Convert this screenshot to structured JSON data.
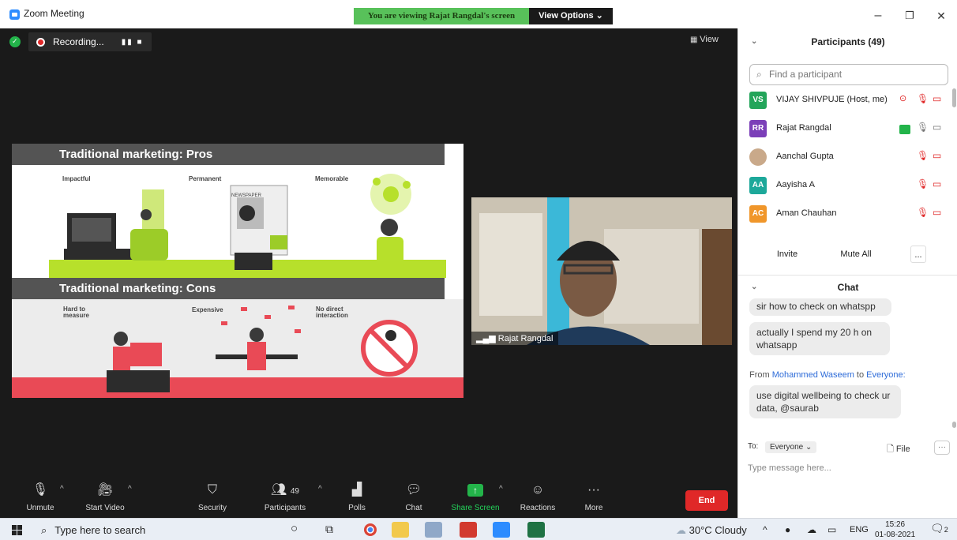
{
  "titlebar": {
    "title": "Zoom Meeting",
    "viewing": "You are viewing Rajat Rangdal's screen",
    "view_options": "View Options ⌄",
    "minimize": "–",
    "restore": "❐",
    "close": "✕"
  },
  "recording": {
    "label": "Recording...",
    "controls": "▮▮ ■"
  },
  "view_button": "View",
  "slide": {
    "pros_title": "Traditional marketing:  Pros",
    "cons_title": "Traditional marketing:  Cons",
    "pros_items": [
      "Impactful",
      "Permanent",
      "Memorable"
    ],
    "cons_items": [
      "Hard to\nmeasure",
      "Expensive",
      "No direct\ninteraction"
    ],
    "newspaper": "NEWSPAPER"
  },
  "video": {
    "name": "Rajat Rangdal"
  },
  "toolbar": {
    "unmute": "Unmute",
    "start_video": "Start Video",
    "security": "Security",
    "participants": "Participants",
    "participants_count": "49",
    "polls": "Polls",
    "chat": "Chat",
    "share_screen": "Share Screen",
    "reactions": "Reactions",
    "more": "More",
    "end": "End"
  },
  "participants_panel": {
    "title": "Participants (49)",
    "search_placeholder": "Find a participant",
    "people": [
      {
        "initials": "VS",
        "name": "VIJAY SHIVPUJE (Host, me)",
        "color": "#23a55a"
      },
      {
        "initials": "RR",
        "name": "Rajat Rangdal",
        "color": "#7b3fb8"
      },
      {
        "initials": "",
        "name": "Aanchal Gupta",
        "color": "#c9a98a"
      },
      {
        "initials": "AA",
        "name": "Aayisha A",
        "color": "#1da89a"
      },
      {
        "initials": "AC",
        "name": "Aman Chauhan",
        "color": "#f0962a"
      }
    ],
    "invite": "Invite",
    "mute_all": "Mute All",
    "more": "..."
  },
  "chat_panel": {
    "title": "Chat",
    "messages": [
      "sir how to check on whatspp",
      "actually I spend my 20 h on whatsapp",
      "use digital wellbeing to check ur data, @saurab"
    ],
    "from_prefix": "From",
    "from_name": "Mohammed Waseem",
    "to_word": "to",
    "to_name": "Everyone:",
    "to_label": "To:",
    "to_value": "Everyone ⌄",
    "file": "File",
    "more": "···",
    "placeholder": "Type message here..."
  },
  "taskbar": {
    "search": "Type here to search",
    "weather": "30°C  Cloudy",
    "lang": "ENG",
    "time": "15:26",
    "date": "01-08-2021",
    "notif_count": "2"
  },
  "colors": {
    "zoom_blue": "#2d8cff",
    "end_red": "#e02828",
    "share_green": "#23b44a",
    "viewing_green": "#58c15a"
  }
}
